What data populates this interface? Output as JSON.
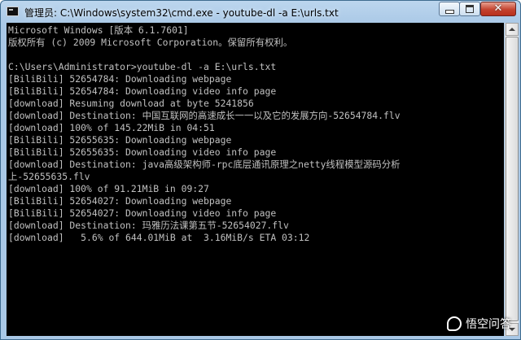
{
  "window": {
    "title": "管理员: C:\\Windows\\system32\\cmd.exe - youtube-dl  -a E:\\urls.txt"
  },
  "controls": {
    "close_glyph": "✕"
  },
  "console": {
    "lines": [
      "Microsoft Windows [版本 6.1.7601]",
      "版权所有 (c) 2009 Microsoft Corporation。保留所有权利。",
      "",
      "C:\\Users\\Administrator>youtube-dl -a E:\\urls.txt",
      "[BiliBili] 52654784: Downloading webpage",
      "[BiliBili] 52654784: Downloading video info page",
      "[download] Resuming download at byte 5241856",
      "[download] Destination: 中国互联网的高速成长一一以及它的发展方向-52654784.flv",
      "[download] 100% of 145.22MiB in 04:51",
      "[BiliBili] 52655635: Downloading webpage",
      "[BiliBili] 52655635: Downloading video info page",
      "[download] Destination: java高级架构师-rpc底层通讯原理之netty线程模型源码分析",
      "上-52655635.flv",
      "[download] 100% of 91.21MiB in 09:27",
      "[BiliBili] 52654027: Downloading webpage",
      "[BiliBili] 52654027: Downloading video info page",
      "[download] Destination: 玛雅历法课第五节-52654027.flv",
      "[download]   5.6% of 644.01MiB at  3.16MiB/s ETA 03:12"
    ]
  },
  "watermark": {
    "text": "悟空问答"
  }
}
